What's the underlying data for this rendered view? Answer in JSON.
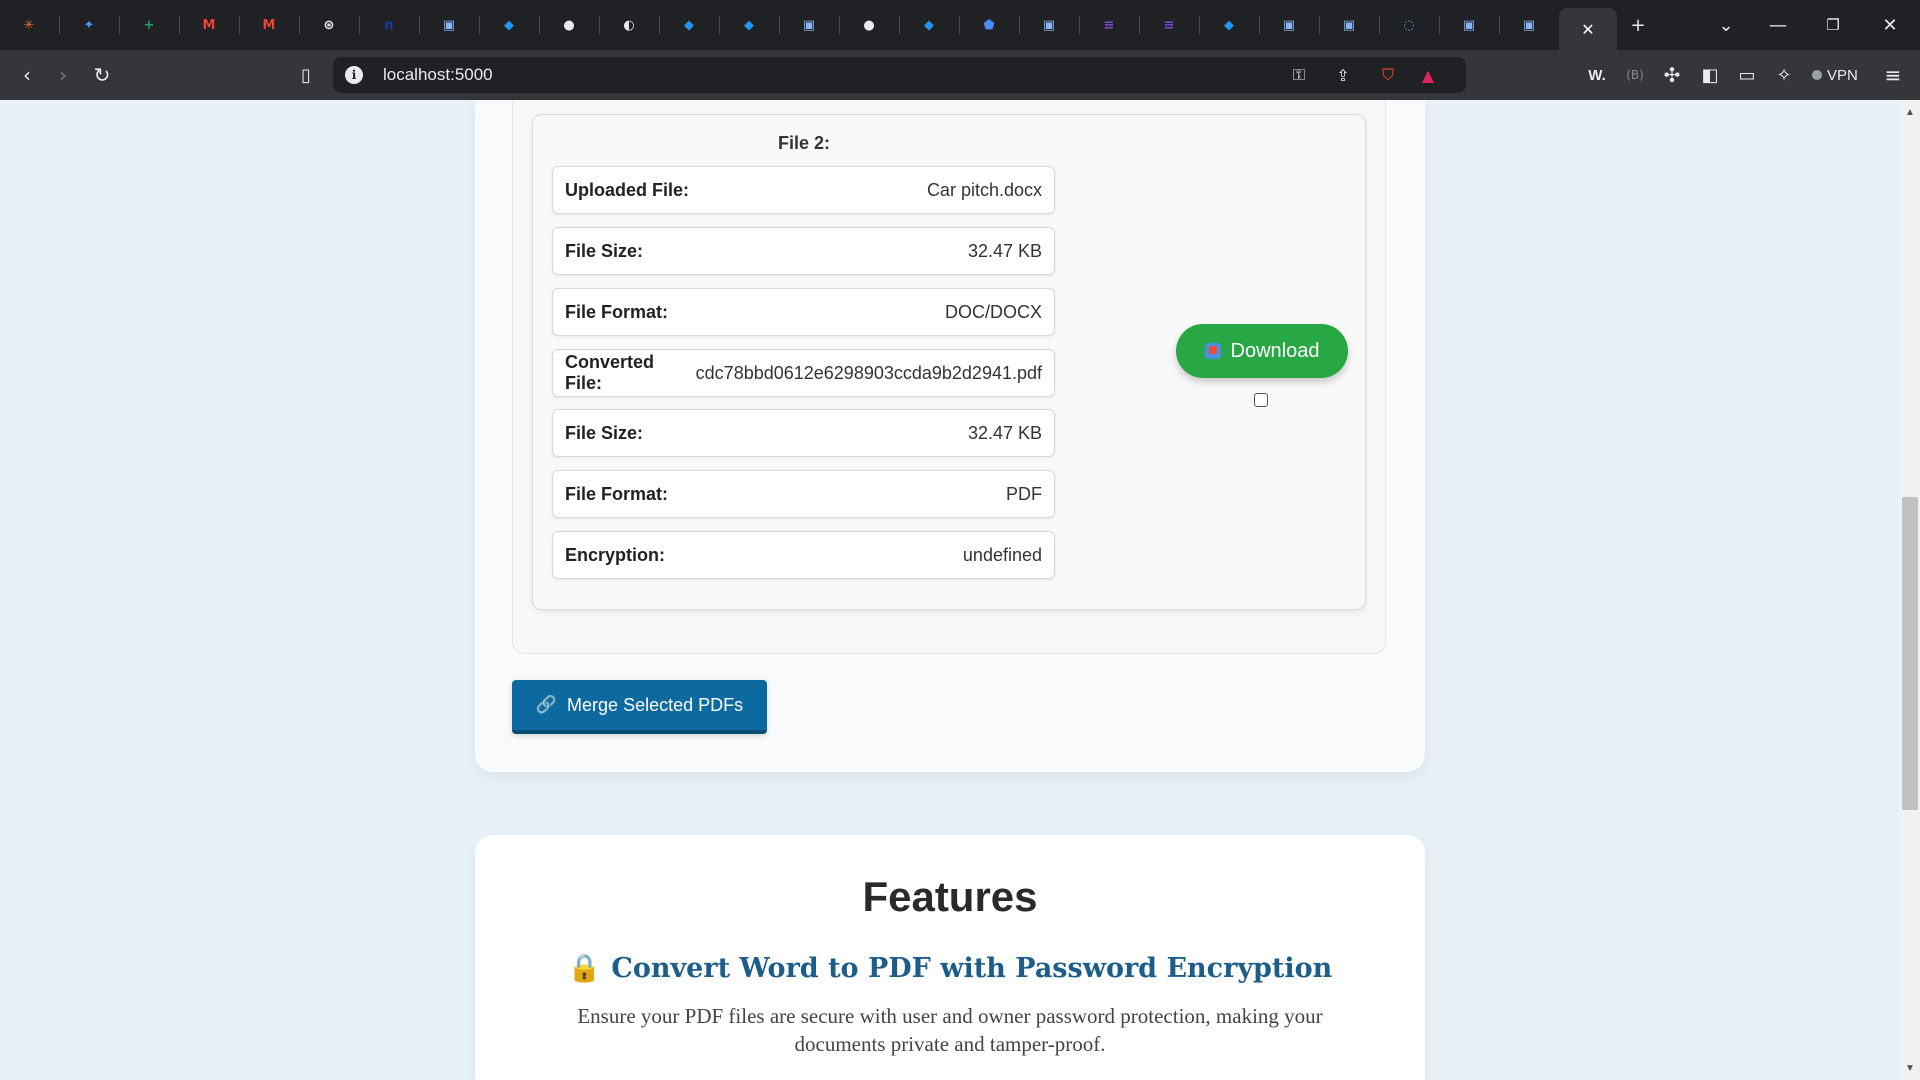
{
  "browser": {
    "url": "localhost:5000",
    "vpn_label": "VPN",
    "wallet_label": "W.",
    "tabs": [
      {
        "icon": "claude-icon",
        "glyph": "✳",
        "color": "#e36d3a"
      },
      {
        "icon": "gemini-icon",
        "glyph": "✦",
        "color": "#4f8ef7"
      },
      {
        "icon": "sheets-icon",
        "glyph": "+",
        "color": "#1fa463"
      },
      {
        "icon": "gmail-icon",
        "glyph": "M",
        "color": "#ea4335"
      },
      {
        "icon": "gmail-icon",
        "glyph": "M",
        "color": "#ea4335"
      },
      {
        "icon": "openai-icon",
        "glyph": "⊛",
        "color": "#e8eaed"
      },
      {
        "icon": "n-app-icon",
        "glyph": "n",
        "color": "#1a3aa8"
      },
      {
        "icon": "page-icon",
        "glyph": "▣",
        "color": "#8ab4f8"
      },
      {
        "icon": "docker-icon",
        "glyph": "◆",
        "color": "#2496ed"
      },
      {
        "icon": "github-icon",
        "glyph": "●",
        "color": "#e8eaed"
      },
      {
        "icon": "globe-icon",
        "glyph": "◐",
        "color": "#e8eaed"
      },
      {
        "icon": "docker-icon",
        "glyph": "◆",
        "color": "#2496ed"
      },
      {
        "icon": "docker-icon",
        "glyph": "◆",
        "color": "#2496ed"
      },
      {
        "icon": "page-icon",
        "glyph": "▣",
        "color": "#8ab4f8"
      },
      {
        "icon": "github-icon",
        "glyph": "●",
        "color": "#e8eaed"
      },
      {
        "icon": "docker-icon",
        "glyph": "◆",
        "color": "#2496ed"
      },
      {
        "icon": "shield-icon",
        "glyph": "⬟",
        "color": "#4c8bf5"
      },
      {
        "icon": "page-icon",
        "glyph": "▣",
        "color": "#8ab4f8"
      },
      {
        "icon": "list-app-icon",
        "glyph": "≡",
        "color": "#7b4ad6"
      },
      {
        "icon": "list-app-icon",
        "glyph": "≡",
        "color": "#7b4ad6"
      },
      {
        "icon": "docker-icon",
        "glyph": "◆",
        "color": "#2496ed"
      },
      {
        "icon": "page-icon",
        "glyph": "▣",
        "color": "#8ab4f8"
      },
      {
        "icon": "page-icon",
        "glyph": "▣",
        "color": "#8ab4f8"
      },
      {
        "icon": "circle-app-icon",
        "glyph": "◌",
        "color": "#5a8fd8"
      },
      {
        "icon": "page-icon",
        "glyph": "▣",
        "color": "#8ab4f8"
      },
      {
        "icon": "page-icon",
        "glyph": "▣",
        "color": "#8ab4f8"
      }
    ]
  },
  "file": {
    "title": "File 2:",
    "rows": [
      {
        "label": "Uploaded File:",
        "value": "Car pitch.docx"
      },
      {
        "label": "File Size:",
        "value": "32.47 KB"
      },
      {
        "label": "File Format:",
        "value": "DOC/DOCX"
      },
      {
        "label": "Converted File:",
        "value": "cdc78bbd0612e6298903ccda9b2d2941.pdf"
      },
      {
        "label": "File Size:",
        "value": "32.47 KB"
      },
      {
        "label": "File Format:",
        "value": "PDF"
      },
      {
        "label": "Encryption:",
        "value": "undefined"
      }
    ],
    "download_label": "Download",
    "selected": false
  },
  "merge_label": "Merge Selected PDFs",
  "features": {
    "title": "Features",
    "subtitle": "Convert Word to PDF with Password Encryption",
    "description": "Ensure your PDF files are secure with user and owner password protection, making your documents private and tamper-proof."
  },
  "colors": {
    "download": "#28a745",
    "merge": "#0d6aa1",
    "feature_heading": "#1d5d8a"
  }
}
